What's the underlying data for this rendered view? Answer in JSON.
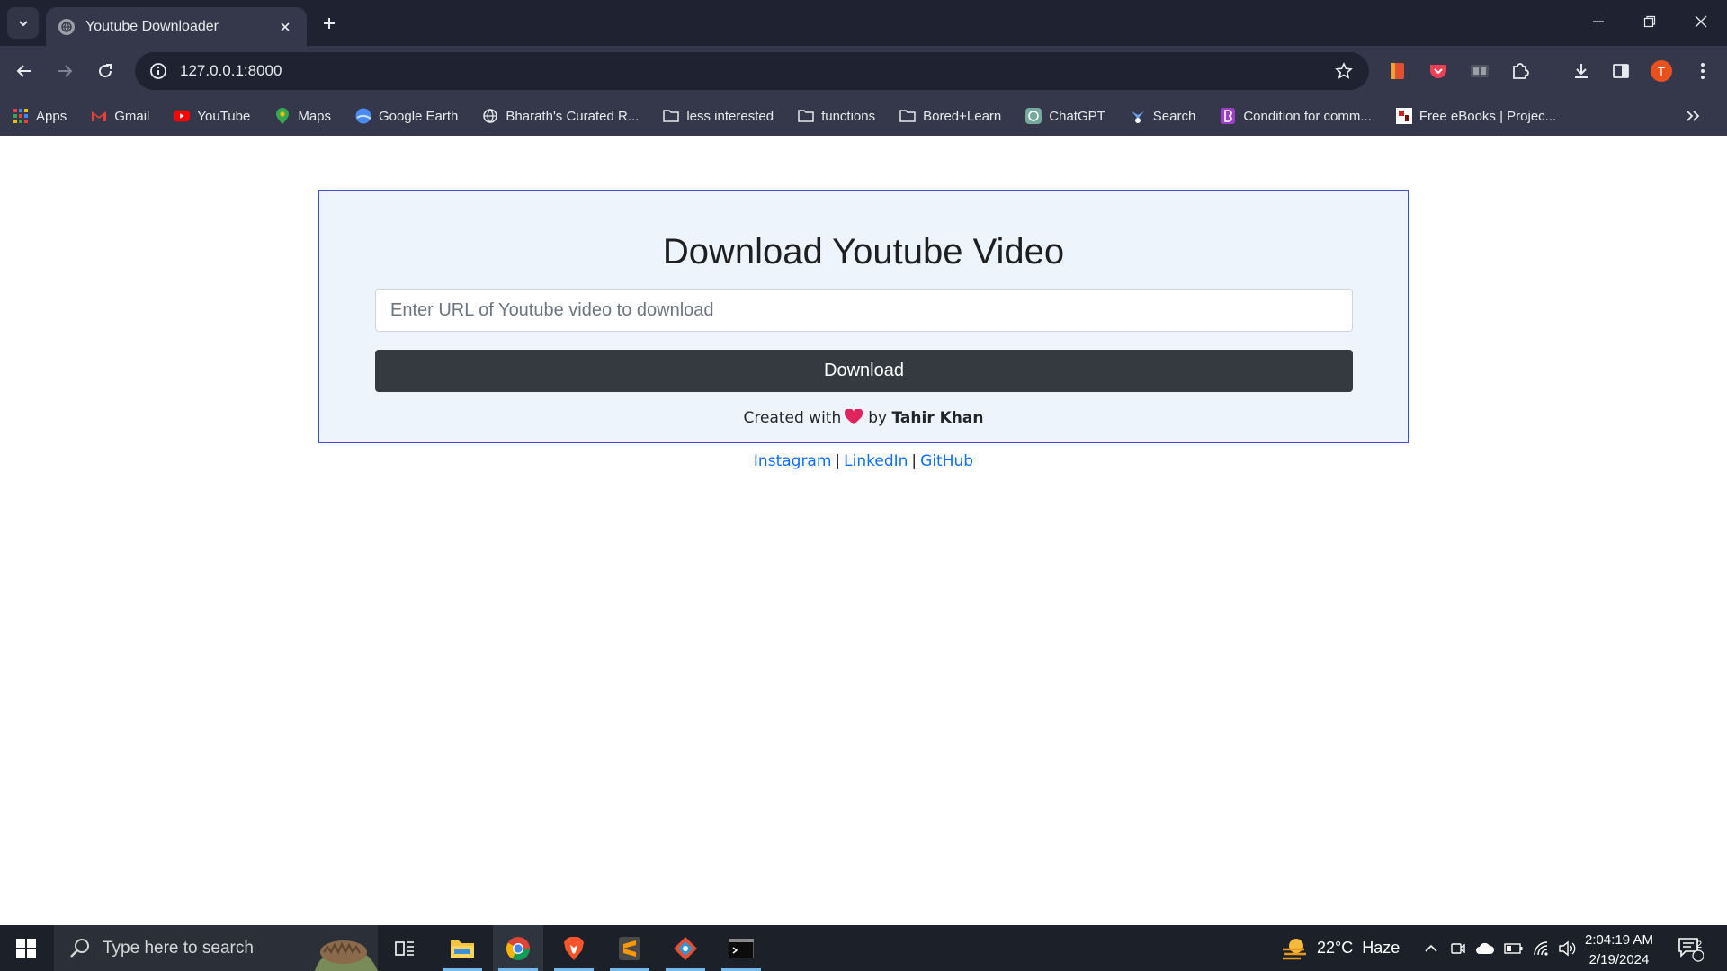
{
  "browser": {
    "tab_title": "Youtube Downloader",
    "url": "127.0.0.1:8000",
    "profile_initial": "T"
  },
  "bookmarks": [
    {
      "label": "Apps",
      "icon": "apps-grid-icon"
    },
    {
      "label": "Gmail",
      "icon": "gmail-icon"
    },
    {
      "label": "YouTube",
      "icon": "youtube-icon"
    },
    {
      "label": "Maps",
      "icon": "maps-pin-icon"
    },
    {
      "label": "Google Earth",
      "icon": "google-earth-icon"
    },
    {
      "label": "Bharath's Curated R...",
      "icon": "globe-icon"
    },
    {
      "label": "less interested",
      "icon": "folder-icon"
    },
    {
      "label": "functions",
      "icon": "folder-icon"
    },
    {
      "label": "Bored+Learn",
      "icon": "folder-icon"
    },
    {
      "label": "ChatGPT",
      "icon": "chatgpt-icon"
    },
    {
      "label": "Search",
      "icon": "search-site-icon"
    },
    {
      "label": "Condition for comm...",
      "icon": "site-b-icon"
    },
    {
      "label": "Free eBooks | Projec...",
      "icon": "gutenberg-icon"
    }
  ],
  "main": {
    "heading": "Download Youtube Video",
    "url_placeholder": "Enter URL of Youtube video to download",
    "download_label": "Download"
  },
  "footer": {
    "created_with": "Created with",
    "by": "by",
    "author": "Tahir Khan",
    "links": [
      "Instagram",
      "LinkedIn",
      "GitHub"
    ],
    "separator": "|"
  },
  "taskbar": {
    "search_placeholder": "Type here to search",
    "weather_temp": "22°C",
    "weather_desc": "Haze",
    "time": "2:04:19 AM",
    "date": "2/19/2024",
    "notification_count": "2"
  },
  "colors": {
    "accent_link": "#0d6efd",
    "button_dark": "#343a40",
    "card_bg": "#eef4fb",
    "card_border": "#3a4fd6"
  }
}
